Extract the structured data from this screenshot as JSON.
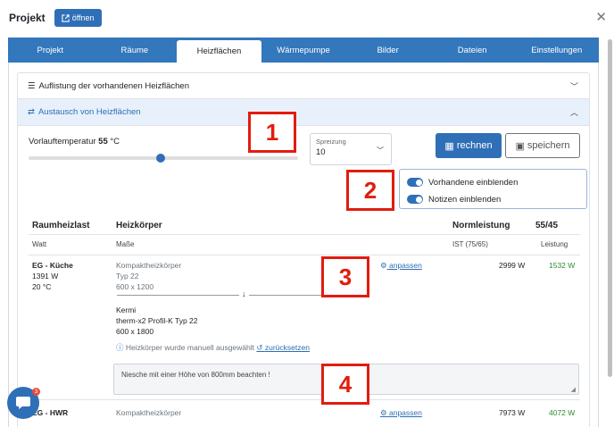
{
  "header": {
    "title": "Projekt",
    "open_button": "öffnen"
  },
  "tabs": [
    {
      "label": "Projekt"
    },
    {
      "label": "Räume"
    },
    {
      "label": "Heizflächen"
    },
    {
      "label": "Wärmepumpe"
    },
    {
      "label": "Bilder"
    },
    {
      "label": "Dateien"
    },
    {
      "label": "Einstellungen"
    }
  ],
  "accordion": {
    "list_title": "Auflistung der vorhandenen Heizflächen",
    "exchange_title": "Austausch von Heizflächen"
  },
  "controls": {
    "vorlauf_label": "Vorlauftemperatur",
    "vorlauf_value": "55",
    "vorlauf_unit": "°C",
    "vorlauf_fraction": 0.49,
    "spreizung_label": "Spreizung",
    "spreizung_value": "10",
    "rechnen": "rechnen",
    "speichern": "speichern",
    "toggle_vorhandene": "Vorhandene einblenden",
    "toggle_notizen": "Notizen einblenden"
  },
  "table": {
    "headers": {
      "raumheizlast": "Raumheizlast",
      "heizkoerper": "Heizkörper",
      "normleistung": "Normleistung",
      "ratio": "55/45"
    },
    "subheaders": {
      "watt": "Watt",
      "masse": "Maße",
      "ist": "IST (75/65)",
      "leistung": "Leistung"
    },
    "rows": [
      {
        "room": "EG - Küche",
        "load": "1391 W",
        "temp": "20 °C",
        "old_type": "Kompaktheizkörper",
        "old_model": "Typ 22",
        "old_size": "600 x 1200",
        "new_brand": "Kermi",
        "new_model": "therm-x2 Profil-K Typ 22",
        "new_size": "600 x 1800",
        "adjust": "anpassen",
        "ist": "2999 W",
        "leistung": "1532 W",
        "manual_note": "Heizkörper wurde manuell ausgewählt",
        "reset": "zurücksetzen",
        "notes": "Niesche mit einer Höhe von 800mm beachten !"
      },
      {
        "room": "EG - HWR",
        "old_type": "Kompaktheizkörper",
        "adjust": "anpassen",
        "ist": "7973 W",
        "leistung": "4072 W"
      }
    ]
  },
  "callouts": [
    "1",
    "2",
    "3",
    "4"
  ],
  "chat": {
    "badge": "3"
  },
  "colors": {
    "primary": "#2f6fb7",
    "success": "#2e8b2e",
    "callout": "#e21c0e"
  }
}
